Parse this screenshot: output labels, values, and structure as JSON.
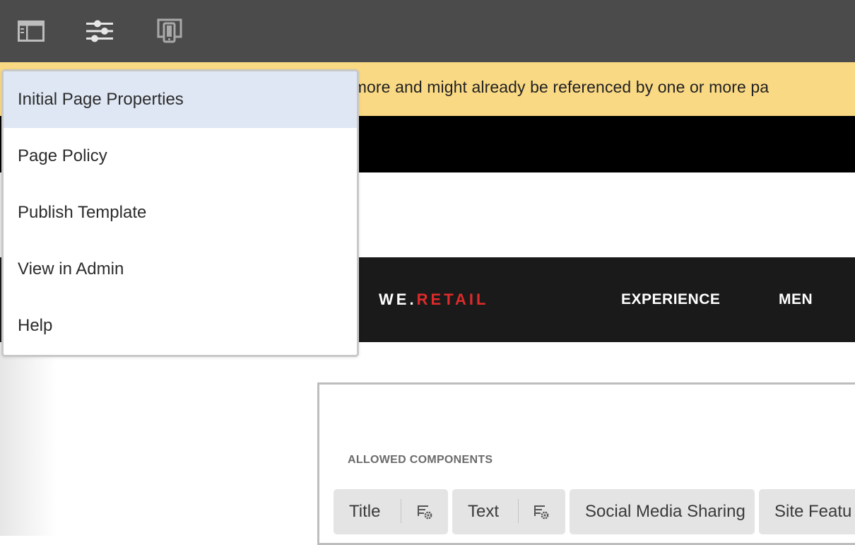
{
  "toolbar": {
    "buttons": [
      {
        "icon": "side-panel-icon"
      },
      {
        "icon": "page-properties-sliders-icon"
      },
      {
        "icon": "emulator-devices-icon"
      }
    ]
  },
  "dropdown_menu": {
    "items": [
      {
        "label": "Initial Page Properties",
        "selected": true
      },
      {
        "label": "Page Policy",
        "selected": false
      },
      {
        "label": "Publish Template",
        "selected": false
      },
      {
        "label": "View in Admin",
        "selected": false
      },
      {
        "label": "Help",
        "selected": false
      }
    ]
  },
  "banner": {
    "text": "a draft anymore and might already be referenced by one or more pa",
    "color": "#fad984"
  },
  "site_header": {
    "logo": {
      "we": "WE",
      "dot": ".",
      "retail": "RETAIL"
    },
    "nav": [
      "EXPERIENCE",
      "MEN"
    ],
    "brand_color": "#e02a2a"
  },
  "layout_container": {
    "allowed_title": "ALLOWED COMPONENTS",
    "components": [
      {
        "label": "Title",
        "has_policy_icon": true
      },
      {
        "label": "Text",
        "has_policy_icon": true
      },
      {
        "label": "Social Media Sharing",
        "has_policy_icon": false
      },
      {
        "label": "Site Featu",
        "has_policy_icon": false
      }
    ]
  }
}
